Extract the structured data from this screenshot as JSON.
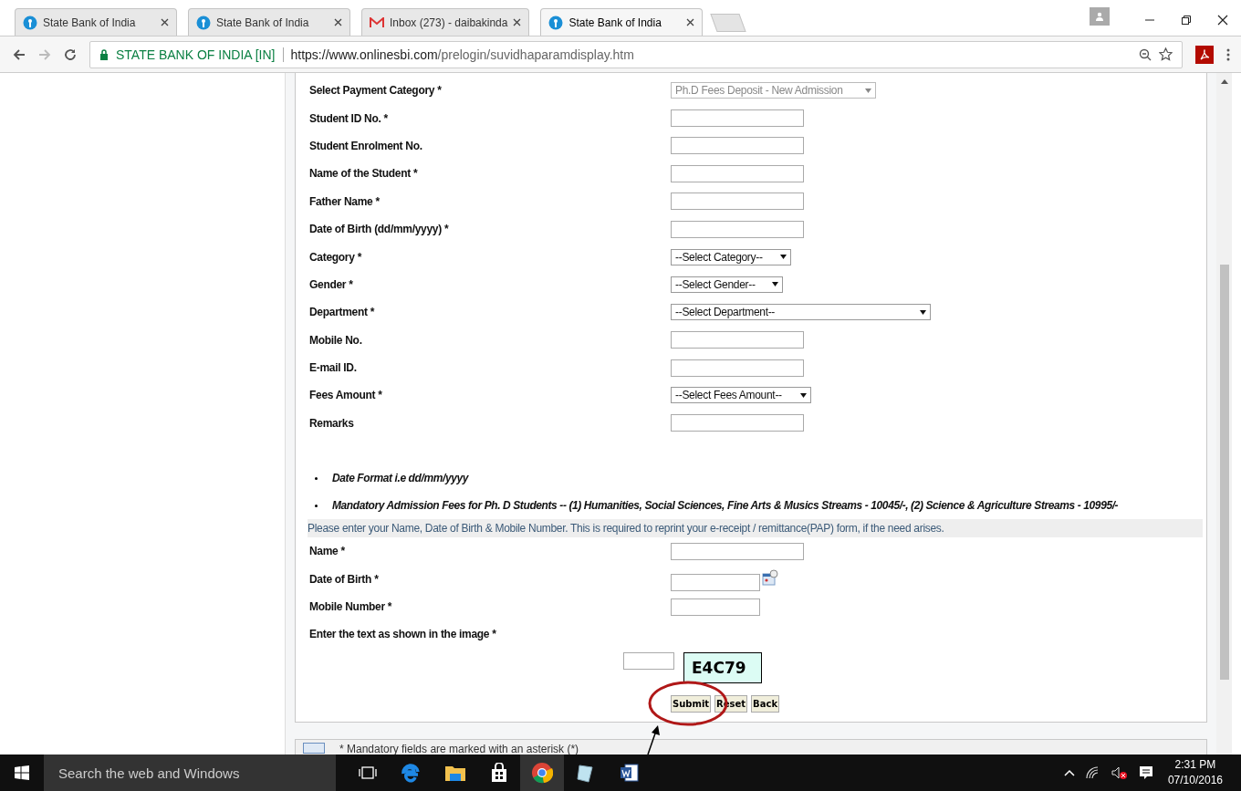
{
  "browser": {
    "tabs": [
      {
        "title": "State Bank of India",
        "kind": "bank",
        "selected": false
      },
      {
        "title": "State Bank of India",
        "kind": "bank",
        "selected": false
      },
      {
        "title": "Inbox (273) - daibakinda",
        "kind": "mail",
        "selected": false
      },
      {
        "title": "State Bank of India",
        "kind": "bank",
        "selected": true
      }
    ],
    "secure_label": "STATE BANK OF INDIA [IN]",
    "url_host": "https://www.onlinesbi.com",
    "url_path": "/prelogin/suvidhaparamdisplay.htm"
  },
  "form": {
    "fields": [
      {
        "label": "Select Payment Category *",
        "kind": "select",
        "value": "Ph.D Fees Deposit - New Admission",
        "disabled": true
      },
      {
        "label": "Student ID No. *",
        "kind": "text"
      },
      {
        "label": "Student Enrolment No.",
        "kind": "text"
      },
      {
        "label": "Name of the Student *",
        "kind": "text"
      },
      {
        "label": "Father Name *",
        "kind": "text"
      },
      {
        "label": "Date of Birth (dd/mm/yyyy) *",
        "kind": "text"
      },
      {
        "label": "Category *",
        "kind": "select",
        "value": "--Select Category--",
        "disabled": false
      },
      {
        "label": "Gender *",
        "kind": "select",
        "value": "--Select Gender--",
        "disabled": false
      },
      {
        "label": "Department *",
        "kind": "select",
        "value": "--Select Department--",
        "disabled": false
      },
      {
        "label": "Mobile No.",
        "kind": "text"
      },
      {
        "label": "E-mail ID.",
        "kind": "text"
      },
      {
        "label": "Fees Amount *",
        "kind": "select",
        "value": "--Select Fees Amount--",
        "disabled": false
      },
      {
        "label": "Remarks",
        "kind": "text"
      }
    ],
    "notes": [
      "Date Format i.e dd/mm/yyyy",
      "Mandatory Admission Fees for Ph. D Students -- (1) Humanities, Social Sciences, Fine Arts & Musics Streams - 10045/-, (2) Science & Agriculture Streams - 10995/-"
    ],
    "notice": "Please enter your Name, Date of Birth & Mobile Number. This is required to reprint your e-receipt / remittance(PAP) form, if the need arises.",
    "reprint_fields": [
      {
        "label": "Name *",
        "kind": "text"
      },
      {
        "label": "Date of Birth *",
        "kind": "date"
      },
      {
        "label": "Mobile Number *",
        "kind": "short"
      }
    ],
    "captcha_label": "Enter the text as shown in the image *",
    "captcha_code": "E4C79",
    "buttons": [
      "Submit",
      "Reset",
      "Back"
    ]
  },
  "footer_note": "* Mandatory fields are marked with an asterisk (*)",
  "taskbar": {
    "search_placeholder": "Search the web and Windows",
    "time": "2:31 PM",
    "date": "07/10/2016"
  }
}
